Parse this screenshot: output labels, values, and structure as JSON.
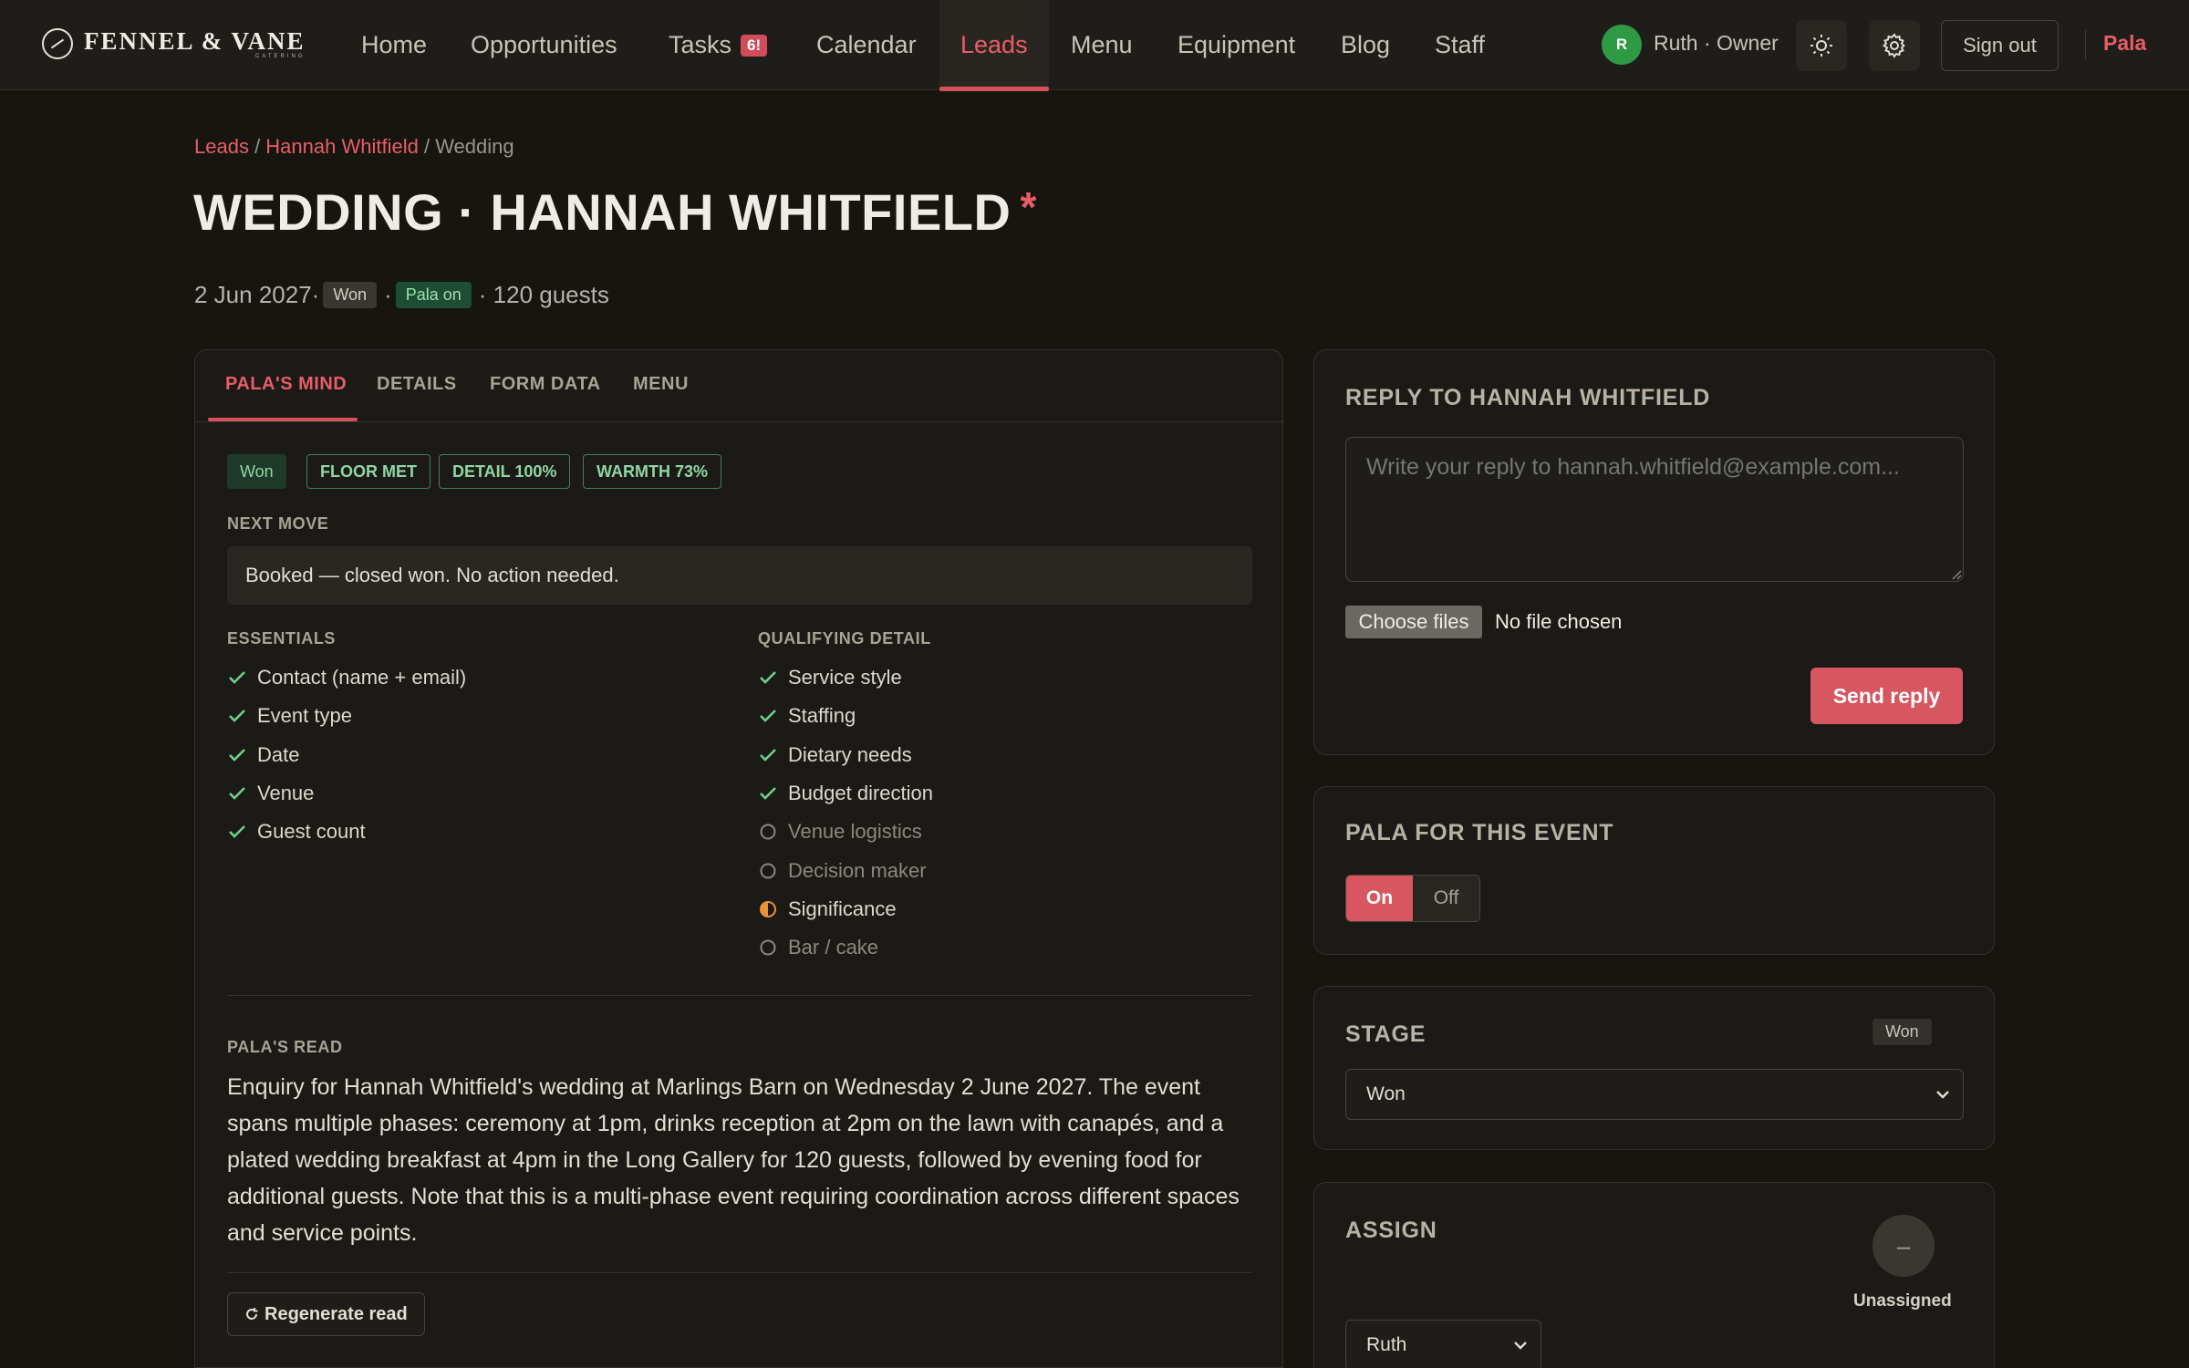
{
  "brand": {
    "name": "FENNEL & VANE",
    "sub": "CATERING"
  },
  "nav": {
    "items": [
      {
        "label": "Home"
      },
      {
        "label": "Opportunities"
      },
      {
        "label": "Tasks",
        "badge": "6!"
      },
      {
        "label": "Calendar"
      },
      {
        "label": "Leads",
        "active": true
      },
      {
        "label": "Menu"
      },
      {
        "label": "Equipment"
      },
      {
        "label": "Blog"
      },
      {
        "label": "Staff"
      }
    ],
    "avatar_initial": "R",
    "user_label": "Ruth · Owner",
    "theme_icon": "sun-icon",
    "settings_icon": "gear-icon",
    "signout_label": "Sign out",
    "pala_label": "Pala"
  },
  "breadcrumb": {
    "root": "Leads",
    "sep1": " / ",
    "person": "Hannah Whitfield",
    "sep2": " / ",
    "current": "Wedding"
  },
  "page": {
    "title": "WEDDING · HANNAH WHITFIELD",
    "asterisk": "*",
    "date": "2 Jun 2027",
    "sep": " · ",
    "stage_pill": "Won",
    "pala_pill": "Pala on",
    "guests": "· 120 guests"
  },
  "tabs": [
    {
      "label": "PALA'S MIND",
      "active": true
    },
    {
      "label": "DETAILS"
    },
    {
      "label": "FORM DATA"
    },
    {
      "label": "MENU"
    }
  ],
  "mind": {
    "tags": [
      "Won",
      "FLOOR MET",
      "DETAIL 100%",
      "WARMTH 73%"
    ],
    "next_move_label": "NEXT MOVE",
    "next_move": "Booked — closed won. No action needed.",
    "essentials_label": "ESSENTIALS",
    "essentials": [
      {
        "label": "Contact (name + email)",
        "status": "done"
      },
      {
        "label": "Event type",
        "status": "done"
      },
      {
        "label": "Date",
        "status": "done"
      },
      {
        "label": "Venue",
        "status": "done"
      },
      {
        "label": "Guest count",
        "status": "done"
      }
    ],
    "qualifying_label": "QUALIFYING DETAIL",
    "qualifying": [
      {
        "label": "Service style",
        "status": "done"
      },
      {
        "label": "Staffing",
        "status": "done"
      },
      {
        "label": "Dietary needs",
        "status": "done"
      },
      {
        "label": "Budget direction",
        "status": "done"
      },
      {
        "label": "Venue logistics",
        "status": "todo"
      },
      {
        "label": "Decision maker",
        "status": "todo"
      },
      {
        "label": "Significance",
        "status": "partial"
      },
      {
        "label": "Bar / cake",
        "status": "todo"
      }
    ],
    "read_label": "PALA'S READ",
    "read_text": "Enquiry for Hannah Whitfield's wedding at Marlings Barn on Wednesday 2 June 2027. The event spans multiple phases: ceremony at 1pm, drinks reception at 2pm on the lawn with canapés, and a plated wedding breakfast at 4pm in the Long Gallery for 120 guests, followed by evening food for additional guests. Note that this is a multi-phase event requiring coordination across different spaces and service points.",
    "regen_label": "Regenerate read"
  },
  "reply": {
    "title": "REPLY TO HANNAH WHITFIELD",
    "placeholder": "Write your reply to hannah.whitfield@example.com...",
    "file_button": "Choose files",
    "file_status": "No file chosen",
    "send_label": "Send reply"
  },
  "pala_event": {
    "title": "PALA FOR THIS EVENT",
    "on_label": "On",
    "off_label": "Off",
    "value": "On"
  },
  "stage": {
    "title": "STAGE",
    "pill": "Won",
    "selected": "Won"
  },
  "assign": {
    "title": "ASSIGN",
    "avatar": "–",
    "status": "Unassigned",
    "selected": "Ruth"
  },
  "colors": {
    "accent": "#d7565f",
    "success": "#8fd6a4",
    "background": "#161510",
    "card": "#1c1a17"
  }
}
